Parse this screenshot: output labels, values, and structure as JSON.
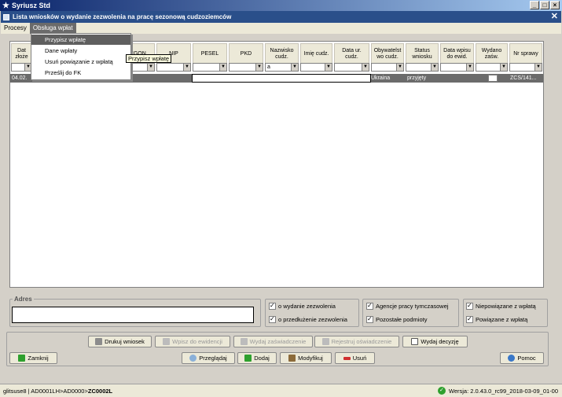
{
  "window": {
    "title": "Syriusz Std",
    "subtitle": "Lista wniosków o wydanie zezwolenia na pracę sezonową cudzoziemców"
  },
  "menubar": {
    "items": [
      "Procesy",
      "Obsługa wpłat"
    ]
  },
  "dropdown": {
    "items": [
      "Przypisz wpłatę",
      "Dane wpłaty",
      "Usuń powiązanie z wpłatą",
      "Prześlij do FK"
    ]
  },
  "tooltip": "Przypisz wpłatę",
  "grid": {
    "headers": [
      "Dat złoże",
      "",
      "",
      "EGON",
      "NIP",
      "PESEL",
      "PKD",
      "Nazwisko cudz.",
      "Imię cudz.",
      "Data ur. cudz.",
      "Obywatelst wo cudz.",
      "Status wniosku",
      "Data wpisu do ewid.",
      "Wydano zaśw.",
      "Nr sprawy"
    ],
    "filter_nazwisko": "a",
    "row": {
      "date": "04.02.",
      "obywatelstwo": "Ukraina",
      "status": "przyjęty",
      "nr_sprawy": "ZCS/141..."
    }
  },
  "address": {
    "label": "Adres"
  },
  "checkboxes": {
    "group1": [
      "o wydanie zezwolenia",
      "o przedłużenie zezwolenia"
    ],
    "group2": [
      "Agencje pracy tymczasowej",
      "Pozostałe podmioty"
    ],
    "group3": [
      "Niepowiązane z wpłatą",
      "Powiązane z wpłatą"
    ]
  },
  "buttons": {
    "drukuj": "Drukuj wniosek",
    "wpisz": "Wpisz do ewidencji",
    "wydaj_zasw": "Wydaj zaświadczenie",
    "rejestruj": "Rejestruj oświadczenie",
    "wydaj_decyzje": "Wydaj decyzję",
    "zamknij": "Zamknij",
    "przegladaj": "Przeglądaj",
    "dodaj": "Dodaj",
    "modyfikuj": "Modyfikuj",
    "usun": "Usuń",
    "pomoc": "Pomoc"
  },
  "status": {
    "path_prefix": "glitsuse8 | AD0001LH>AD0000>",
    "path_bold": "ZC0002L",
    "version": "Wersja: 2.0.43.0_rc99_2018-03-09_01-00"
  },
  "colors": {
    "title_bg": "#0a246a",
    "subtitle_bg": "#2a4f8a",
    "selection": "#6b6b6b"
  }
}
